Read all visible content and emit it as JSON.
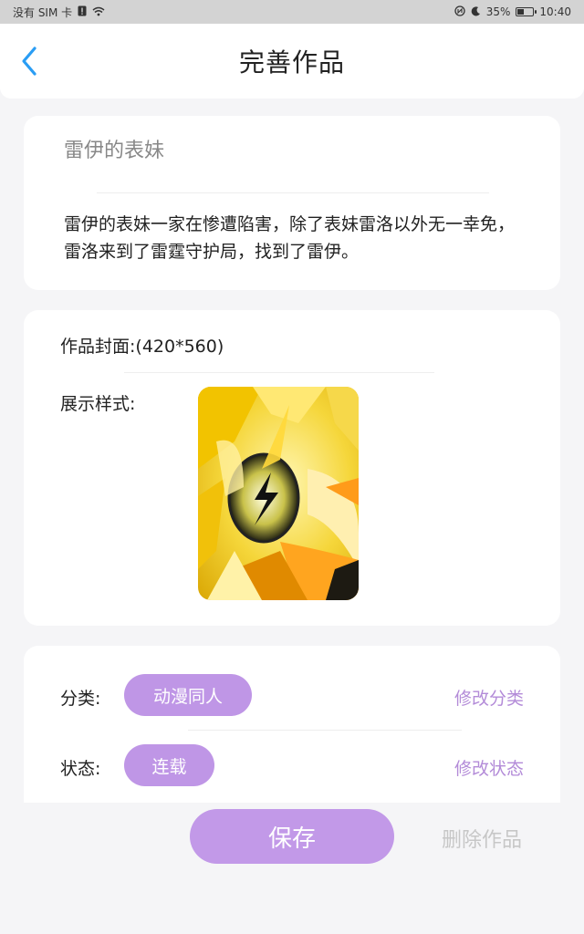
{
  "status_bar": {
    "carrier": "没有 SIM 卡",
    "battery_percent": "35%",
    "battery_level": 0.35,
    "time": "10:40",
    "icons": [
      "sim-alert-icon",
      "wifi-icon",
      "nfc-icon",
      "moon-icon",
      "battery-icon"
    ]
  },
  "header": {
    "title": "完善作品",
    "back_icon": "chevron-left-icon",
    "accent_color": "#2a9df4"
  },
  "work": {
    "title": "雷伊的表妹",
    "description": "雷伊的表妹一家在惨遭陷害，除了表妹雷洛以外无一幸免，雷洛来到了雷霆守护局，找到了雷伊。"
  },
  "cover": {
    "label": "作品封面:(420*560)",
    "style_label": "展示样式:"
  },
  "meta": {
    "category_label": "分类:",
    "category_value": "动漫同人",
    "category_modify": "修改分类",
    "status_label": "状态:",
    "status_value": "连载",
    "status_modify": "修改状态"
  },
  "actions": {
    "save_label": "保存",
    "delete_label": "删除作品"
  },
  "colors": {
    "chip_purple": "#bf96e6",
    "link_purple": "#b38bd8",
    "background": "#f5f5f7"
  }
}
